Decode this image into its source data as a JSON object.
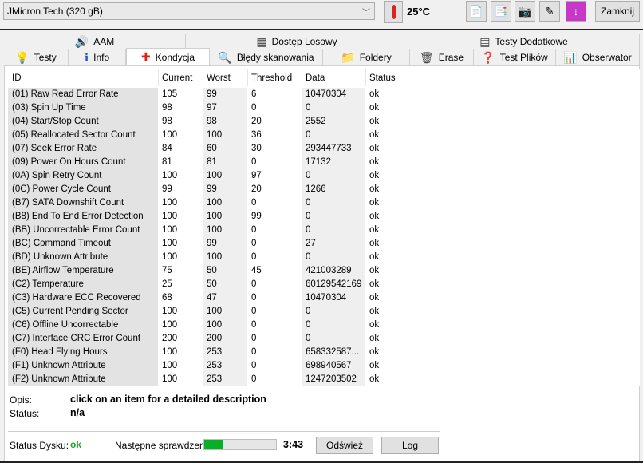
{
  "drive": {
    "selected": "JMicron Tech (320 gB)"
  },
  "toolbar": {
    "temperature": "25°C",
    "close_label": "Zamknij",
    "icons": [
      "copy-text-icon",
      "copy-screenshot-icon",
      "camera-icon",
      "options-icon",
      "save-down-icon"
    ]
  },
  "tabs_row1": [
    {
      "label": "AAM",
      "icon": "speaker-icon"
    },
    {
      "label": "Dostęp Losowy",
      "icon": "random-access-icon"
    },
    {
      "label": "Testy Dodatkowe",
      "icon": "extra-tests-icon"
    }
  ],
  "tabs_row2": [
    {
      "label": "Testy",
      "icon": "bulb-icon"
    },
    {
      "label": "Info",
      "icon": "info-icon"
    },
    {
      "label": "Kondycja",
      "icon": "health-cross-icon",
      "active": true
    },
    {
      "label": "Błędy skanowania",
      "icon": "magnifier-icon"
    },
    {
      "label": "Foldery",
      "icon": "folder-icon"
    },
    {
      "label": "Erase",
      "icon": "trash-icon"
    },
    {
      "label": "Test Plików",
      "icon": "file-test-icon"
    },
    {
      "label": "Obserwator",
      "icon": "monitor-chart-icon"
    }
  ],
  "table": {
    "columns": [
      "ID",
      "Current",
      "Worst",
      "Threshold",
      "Data",
      "Status"
    ],
    "rows": [
      [
        "(01) Raw Read Error Rate",
        "105",
        "99",
        "6",
        "10470304",
        "ok"
      ],
      [
        "(03) Spin Up Time",
        "98",
        "97",
        "0",
        "0",
        "ok"
      ],
      [
        "(04) Start/Stop Count",
        "98",
        "98",
        "20",
        "2552",
        "ok"
      ],
      [
        "(05) Reallocated Sector Count",
        "100",
        "100",
        "36",
        "0",
        "ok"
      ],
      [
        "(07) Seek Error Rate",
        "84",
        "60",
        "30",
        "293447733",
        "ok"
      ],
      [
        "(09) Power On Hours Count",
        "81",
        "81",
        "0",
        "17132",
        "ok"
      ],
      [
        "(0A) Spin Retry Count",
        "100",
        "100",
        "97",
        "0",
        "ok"
      ],
      [
        "(0C) Power Cycle Count",
        "99",
        "99",
        "20",
        "1266",
        "ok"
      ],
      [
        "(B7) SATA Downshift Count",
        "100",
        "100",
        "0",
        "0",
        "ok"
      ],
      [
        "(B8) End To End Error Detection",
        "100",
        "100",
        "99",
        "0",
        "ok"
      ],
      [
        "(BB) Uncorrectable Error Count",
        "100",
        "100",
        "0",
        "0",
        "ok"
      ],
      [
        "(BC) Command Timeout",
        "100",
        "99",
        "0",
        "27",
        "ok"
      ],
      [
        "(BD) Unknown Attribute",
        "100",
        "100",
        "0",
        "0",
        "ok"
      ],
      [
        "(BE) Airflow Temperature",
        "75",
        "50",
        "45",
        "421003289",
        "ok"
      ],
      [
        "(C2) Temperature",
        "25",
        "50",
        "0",
        "60129542169",
        "ok"
      ],
      [
        "(C3) Hardware ECC Recovered",
        "68",
        "47",
        "0",
        "10470304",
        "ok"
      ],
      [
        "(C5) Current Pending Sector",
        "100",
        "100",
        "0",
        "0",
        "ok"
      ],
      [
        "(C6) Offline Uncorrectable",
        "100",
        "100",
        "0",
        "0",
        "ok"
      ],
      [
        "(C7) Interface CRC Error Count",
        "200",
        "200",
        "0",
        "0",
        "ok"
      ],
      [
        "(F0) Head Flying Hours",
        "100",
        "253",
        "0",
        "658332587...",
        "ok"
      ],
      [
        "(F1) Unknown Attribute",
        "100",
        "253",
        "0",
        "698940567",
        "ok"
      ],
      [
        "(F2) Unknown Attribute",
        "100",
        "253",
        "0",
        "1247203502",
        "ok"
      ]
    ]
  },
  "description": {
    "opis_label": "Opis:",
    "opis_value": "click on an item for a detailed description",
    "status_label": "Status:",
    "status_value": "n/a"
  },
  "footer": {
    "disk_status_label": "Status Dysku:",
    "disk_status_value": "ok",
    "next_check_label": "Następne sprawdzenie:",
    "progress_percent": 25,
    "time": "3:43",
    "refresh_label": "Odśwież",
    "log_label": "Log",
    "ok_color": "#22a822",
    "progress_color": "#06b025"
  }
}
